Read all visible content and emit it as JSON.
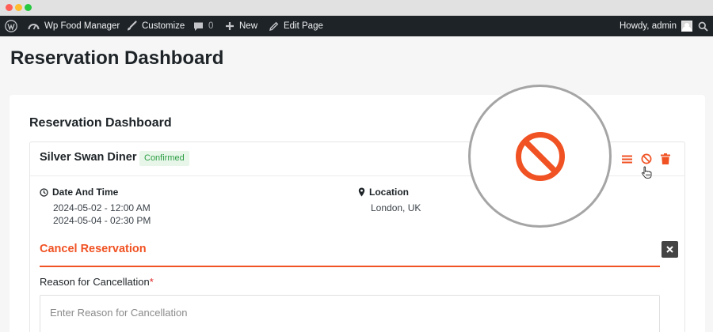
{
  "admin_bar": {
    "site_name": "Wp Food Manager",
    "customize": "Customize",
    "comments_count": "0",
    "new_label": "New",
    "edit_page": "Edit Page",
    "howdy": "Howdy, admin"
  },
  "page": {
    "title": "Reservation Dashboard"
  },
  "dashboard": {
    "section_title": "Reservation Dashboard",
    "reservation": {
      "name": "Silver Swan Diner",
      "status": "Confirmed",
      "date_label": "Date And Time",
      "dates": [
        "2024-05-02 - 12:00 AM",
        "2024-05-04 - 02:30 PM"
      ],
      "location_label": "Location",
      "location": "London, UK"
    },
    "actions": [
      "menu-icon",
      "cancel-icon",
      "trash-icon"
    ]
  },
  "cancel_form": {
    "title": "Cancel Reservation",
    "reason_label": "Reason for Cancellation",
    "required_mark": "*",
    "reason_placeholder": "Enter Reason for Cancellation"
  },
  "colors": {
    "accent": "#f05223",
    "admin_bar": "#1d2327",
    "badge_bg": "#e7f6e9",
    "badge_text": "#2e9e44"
  }
}
